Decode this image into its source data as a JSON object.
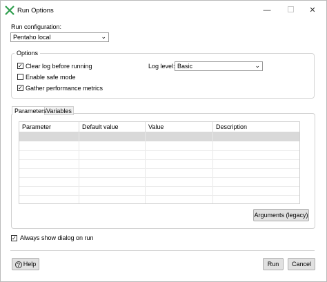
{
  "window": {
    "title": "Run Options",
    "icon": "pentaho-kettle-icon",
    "controls": [
      "minimize",
      "maximize",
      "close"
    ]
  },
  "run_configuration": {
    "label": "Run configuration:",
    "value": "Pentaho local"
  },
  "options": {
    "legend": "Options",
    "clear_log": {
      "label": "Clear log before running",
      "checked": true
    },
    "safe_mode": {
      "label": "Enable safe mode",
      "checked": false
    },
    "perf_metrics": {
      "label": "Gather performance metrics",
      "checked": true
    },
    "log_level": {
      "label": "Log level:",
      "value": "Basic"
    }
  },
  "tabs": [
    {
      "label": "Parameters",
      "active": true
    },
    {
      "label": "Variables",
      "active": false
    }
  ],
  "parameters_table": {
    "columns": [
      "Parameter",
      "Default value",
      "Value",
      "Description"
    ],
    "rows": []
  },
  "buttons": {
    "arguments": "Arguments (legacy)",
    "help": "Help",
    "run": "Run",
    "cancel": "Cancel"
  },
  "always_show": {
    "label": "Always show dialog on run",
    "checked": true
  }
}
